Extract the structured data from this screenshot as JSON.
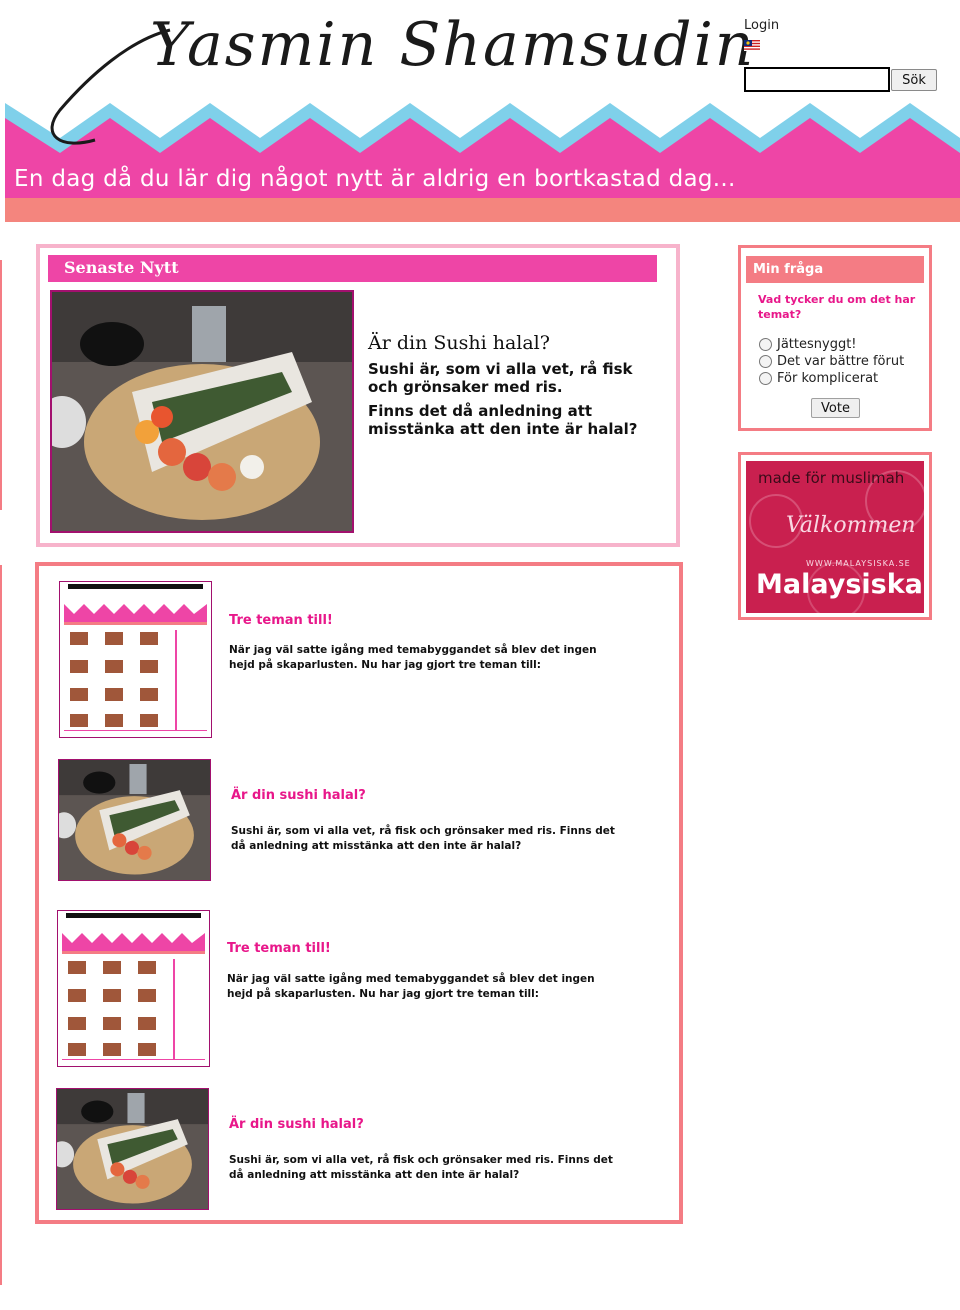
{
  "header": {
    "site_title": "Yasmin Shamsudin",
    "tagline": "En dag då du lär dig något nytt är aldrig en bortkastad dag...",
    "login_label": "Login",
    "flags": [
      "swedish-flag-icon",
      "us-flag-icon",
      "uae-flag-icon",
      "indonesian-flag-icon",
      "thai-flag-icon",
      "malaysian-flag-icon"
    ],
    "search": {
      "value": "",
      "button_label": "Sök"
    }
  },
  "latest": {
    "heading": "Senaste Nytt",
    "title": "Är din Sushi halal?",
    "paragraphs": [
      "Sushi är, som vi alla vet, rå fisk och grönsaker med ris.",
      "Finns det då anledning att misstänka att den inte är halal?"
    ]
  },
  "articles": [
    {
      "title": "Tre teman till!",
      "text": "När jag väl satte igång med temabyggandet så blev det ingen hejd på skaparlusten. Nu har jag gjort tre teman till:",
      "thumb": "theme-screenshot"
    },
    {
      "title": "Är din sushi halal?",
      "text": "Sushi är, som vi alla vet, rå fisk och grönsaker med ris. Finns det då anledning att misstänka att den inte är halal?",
      "thumb": "sushi-photo"
    },
    {
      "title": "Tre teman till!",
      "text": "När jag väl satte igång med temabyggandet så blev det ingen hejd på skaparlusten. Nu har jag gjort tre teman till:",
      "thumb": "theme-screenshot"
    },
    {
      "title": "Är din sushi halal?",
      "text": "Sushi är, som vi alla vet, rå fisk och grönsaker med ris. Finns det då anledning att misstänka att den inte är halal?",
      "thumb": "sushi-photo"
    }
  ],
  "poll": {
    "heading": "Min fråga",
    "question": "Vad tycker du om det har temat?",
    "options": [
      "Jättesnyggt!",
      "Det var bättre förut",
      "För komplicerat"
    ],
    "vote_label": "Vote"
  },
  "banner": {
    "top_text": "made för muslimah",
    "welcome": "Välkommen",
    "url": "WWW.MALAYSISKA.SE",
    "name": "Malaysiska"
  },
  "colors": {
    "pink": "#ee45a6",
    "coral": "#f47c84",
    "light_pink": "#f7b3cb",
    "sky_blue": "#7fd0ea",
    "title_pink": "#e8178a"
  }
}
